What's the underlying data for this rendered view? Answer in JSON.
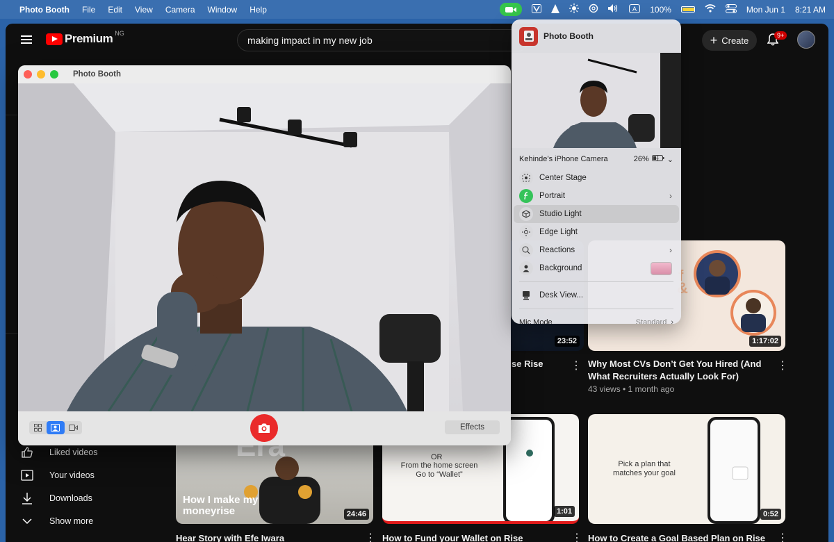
{
  "menubar": {
    "app": "Photo Booth",
    "menus": [
      "File",
      "Edit",
      "View",
      "Camera",
      "Window",
      "Help"
    ],
    "battery": "100%",
    "date": "Mon Jun 1",
    "time": "8:21 AM"
  },
  "youtube": {
    "logo": "Premium",
    "region": "NG",
    "search_value": "making impact in my new job",
    "create_label": "Create",
    "notif_count": "9+",
    "sidebar": [
      {
        "label": "Liked videos",
        "icon": "thumbs-up-icon"
      },
      {
        "label": "Your videos",
        "icon": "play-square-icon"
      },
      {
        "label": "Downloads",
        "icon": "download-icon"
      },
      {
        "label": "Show more",
        "icon": "chevron-down-icon"
      }
    ],
    "videos": [
      {
        "title_fragment": "se Rise",
        "duration": "23:52"
      },
      {
        "title": "Why Most CVs Don’t Get You Hired (And What Recruiters Actually Look For)",
        "meta": "43 views • 1 month ago",
        "duration": "1:17:02"
      },
      {
        "duration": "24:46",
        "overlay": "How I make my moneyrise",
        "title_fragment": "Hear Story with Efe Iwara"
      },
      {
        "duration": "1:01",
        "overlay_top": "OR",
        "overlay": "From the home screen Go to “Wallet”",
        "title_fragment": "How to Fund your Wallet on Rise"
      },
      {
        "duration": "0:52",
        "overlay": "Pick a plan that matches your goal",
        "title_fragment": "How to Create a Goal Based Plan on Rise"
      }
    ]
  },
  "photobooth": {
    "title": "Photo Booth",
    "effects_label": "Effects"
  },
  "control_center": {
    "app_name": "Photo Booth",
    "camera_name": "Kehinde’s iPhone Camera",
    "camera_battery": "26%",
    "items": [
      {
        "label": "Center Stage"
      },
      {
        "label": "Portrait"
      },
      {
        "label": "Studio Light"
      },
      {
        "label": "Edge Light"
      },
      {
        "label": "Reactions"
      },
      {
        "label": "Background"
      },
      {
        "label": "Desk View..."
      }
    ],
    "mic_mode_label": "Mic Mode",
    "mic_mode_value": "Standard"
  }
}
